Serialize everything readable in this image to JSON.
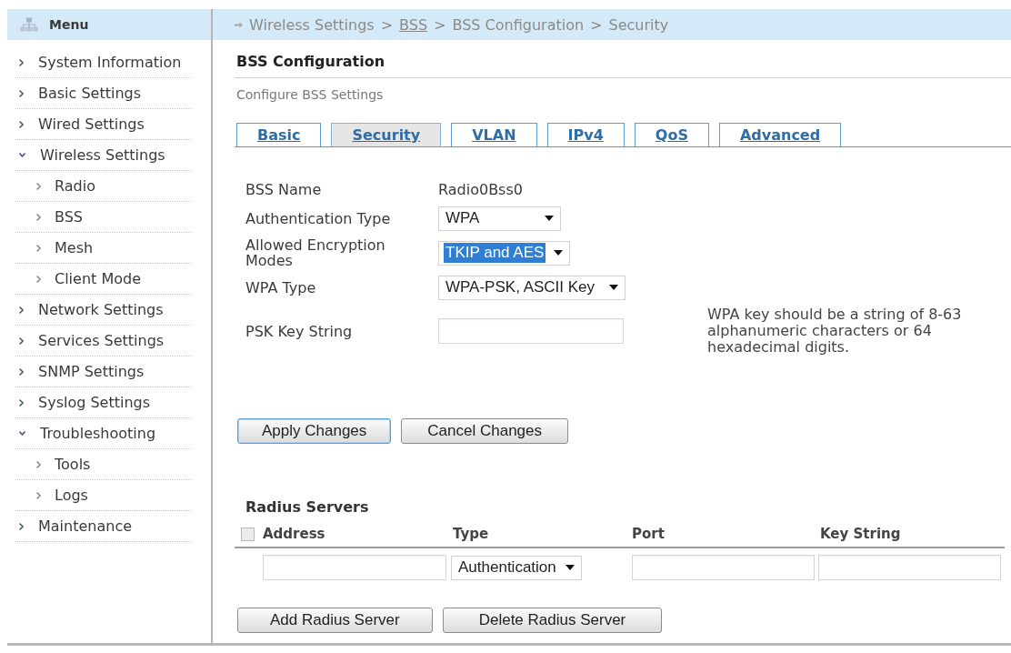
{
  "sidebar": {
    "title": "Menu",
    "items": [
      {
        "label": "System Information",
        "expanded": false
      },
      {
        "label": "Basic Settings",
        "expanded": false
      },
      {
        "label": "Wired Settings",
        "expanded": false
      },
      {
        "label": "Wireless Settings",
        "expanded": true,
        "children": [
          {
            "label": "Radio",
            "expanded": false
          },
          {
            "label": "BSS",
            "expanded": false
          },
          {
            "label": "Mesh",
            "expanded": false
          },
          {
            "label": "Client Mode",
            "expanded": false
          }
        ]
      },
      {
        "label": "Network Settings",
        "expanded": false
      },
      {
        "label": "Services Settings",
        "expanded": false
      },
      {
        "label": "SNMP Settings",
        "expanded": false
      },
      {
        "label": "Syslog Settings",
        "expanded": false
      },
      {
        "label": "Troubleshooting",
        "expanded": true,
        "children": [
          {
            "label": "Tools",
            "expanded": false
          },
          {
            "label": "Logs",
            "expanded": false
          }
        ]
      },
      {
        "label": "Maintenance",
        "expanded": false
      }
    ]
  },
  "breadcrumb": {
    "separator": ">",
    "items": [
      {
        "label": "Wireless Settings",
        "link": false
      },
      {
        "label": "BSS",
        "link": true
      },
      {
        "label": "BSS Configuration",
        "link": false
      },
      {
        "label": "Security",
        "link": false
      }
    ]
  },
  "page": {
    "title": "BSS Configuration",
    "subtitle": "Configure BSS Settings"
  },
  "tabs": [
    {
      "label": "Basic",
      "selected": false
    },
    {
      "label": "Security",
      "selected": true
    },
    {
      "label": "VLAN",
      "selected": false
    },
    {
      "label": "IPv4",
      "selected": false
    },
    {
      "label": "QoS",
      "selected": false
    },
    {
      "label": "Advanced",
      "selected": false
    }
  ],
  "form": {
    "fields": [
      {
        "kind": "text",
        "label": "BSS Name",
        "value": "Radio0Bss0"
      },
      {
        "kind": "select",
        "label": "Authentication Type",
        "value": "WPA",
        "highlighted": false
      },
      {
        "kind": "select",
        "label": "Allowed Encryption Modes",
        "value": "TKIP and AES",
        "highlighted": true
      },
      {
        "kind": "select",
        "label": "WPA Type",
        "value": "WPA-PSK, ASCII Key",
        "highlighted": false
      },
      {
        "kind": "input",
        "label": "PSK Key String",
        "note": "WPA key should be a string of 8-63 alphanumeric characters or 64 hexadecimal digits."
      }
    ]
  },
  "actions": [
    {
      "label": "Apply Changes",
      "focused": true
    },
    {
      "label": "Cancel Changes",
      "focused": false
    }
  ],
  "radius": {
    "title": "Radius Servers",
    "select_all": {
      "checked": false
    },
    "columns": [
      "Address",
      "Type",
      "Port",
      "Key String"
    ],
    "rows": [
      {
        "type": "Authentication"
      }
    ],
    "buttons": [
      "Add Radius Server",
      "Delete Radius Server"
    ]
  }
}
